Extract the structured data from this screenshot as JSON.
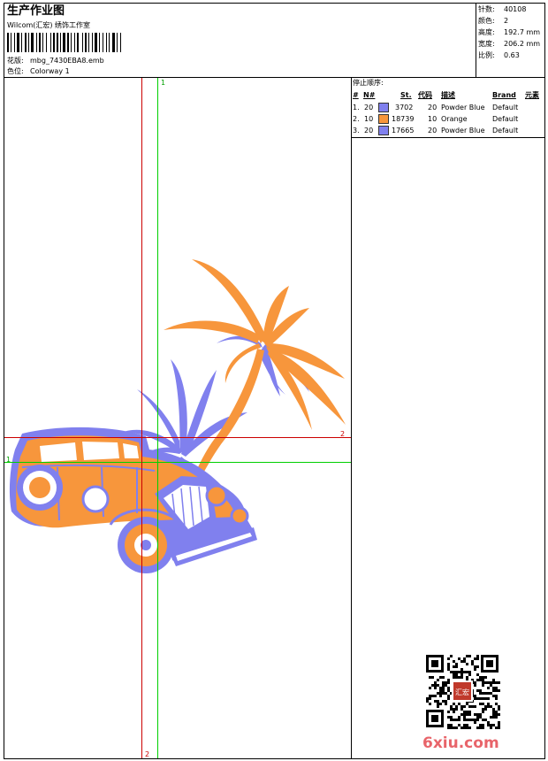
{
  "header": {
    "title": "生产作业图",
    "studio": "Wilcom(汇宏) 绣饰工作室",
    "design_label": "花版:",
    "design_file": "mbg_7430EBA8.emb",
    "colorway_label": "色位:",
    "colorway": "Colorway 1"
  },
  "stats": [
    {
      "label": "针数:",
      "value": "40108"
    },
    {
      "label": "颜色:",
      "value": "2"
    },
    {
      "label": "高度:",
      "value": "192.7 mm"
    },
    {
      "label": "宽度:",
      "value": "206.2 mm"
    },
    {
      "label": "比例:",
      "value": "0.63"
    }
  ],
  "stop_sequence": {
    "title": "停止顺序:",
    "columns": [
      "#",
      "N#",
      "St.",
      "代码",
      "描述",
      "Brand",
      "元素"
    ],
    "rows": [
      {
        "index": "1.",
        "n": "20",
        "color": "#8080ee",
        "st": "3702",
        "code": "20",
        "desc": "Powder Blue",
        "brand": "Default"
      },
      {
        "index": "2.",
        "n": "10",
        "color": "#f7963c",
        "st": "18739",
        "code": "10",
        "desc": "Orange",
        "brand": "Default"
      },
      {
        "index": "3.",
        "n": "20",
        "color": "#8080ee",
        "st": "17665",
        "code": "20",
        "desc": "Powder Blue",
        "brand": "Default"
      }
    ]
  },
  "guides": {
    "green_top": "1",
    "green_left": "1",
    "red_right": "2",
    "red_bottom": "2",
    "green_color": "#00d000",
    "red_color": "#cc0000"
  },
  "colors": {
    "orange": "#f7963c",
    "blue": "#8080ee"
  },
  "watermark": {
    "site": "6xiu.com",
    "seal": "汇宏",
    "qr": "qr-code"
  }
}
